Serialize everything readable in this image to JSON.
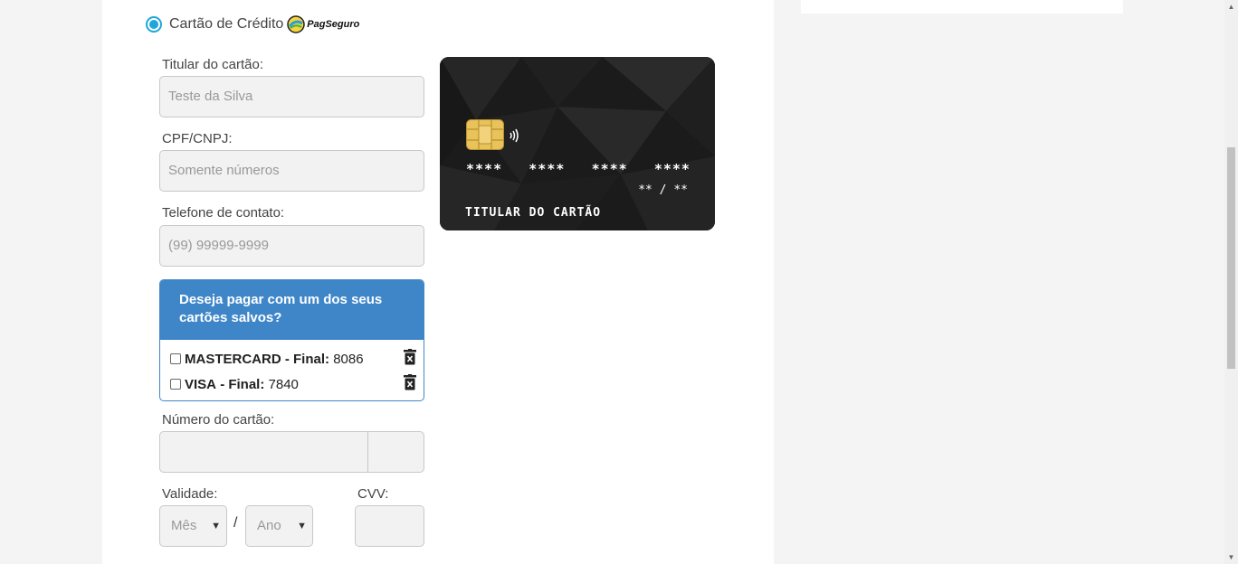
{
  "payment_option": {
    "label": "Cartão de Crédito",
    "provider": "PagSeguro"
  },
  "fields": {
    "holder": {
      "label": "Titular do cartão:",
      "placeholder": "Teste da Silva"
    },
    "document": {
      "label": "CPF/CNPJ:",
      "placeholder": "Somente números"
    },
    "phone": {
      "label": "Telefone de contato:",
      "placeholder": "(99) 99999-9999"
    },
    "card_number": {
      "label": "Número do cartão:"
    },
    "expiry": {
      "label": "Validade:",
      "month_placeholder": "Mês",
      "year_placeholder": "Ano",
      "separator": "/"
    },
    "cvv": {
      "label": "CVV:"
    }
  },
  "saved_cards": {
    "title": "Deseja pagar com um dos seus cartões salvos?",
    "items": [
      {
        "brand": "MASTERCARD",
        "sep": "- Final:",
        "last4": "8086"
      },
      {
        "brand": "VISA",
        "sep": "- Final:",
        "last4": "7840"
      }
    ]
  },
  "card_preview": {
    "number_groups": [
      "****",
      "****",
      "****",
      "****"
    ],
    "expiry": "** / **",
    "holder": "TITULAR DO CARTÃO"
  },
  "icons": {
    "radio": "radio-selected-icon",
    "trash": "trash-icon",
    "chip": "chip-icon",
    "contactless": "contactless-icon",
    "provider_logo": "pagseguro-logo-icon"
  },
  "colors": {
    "accent": "#1ea7d8",
    "saved_header": "#3f86c8",
    "card_bg": "#1a1a1a"
  }
}
